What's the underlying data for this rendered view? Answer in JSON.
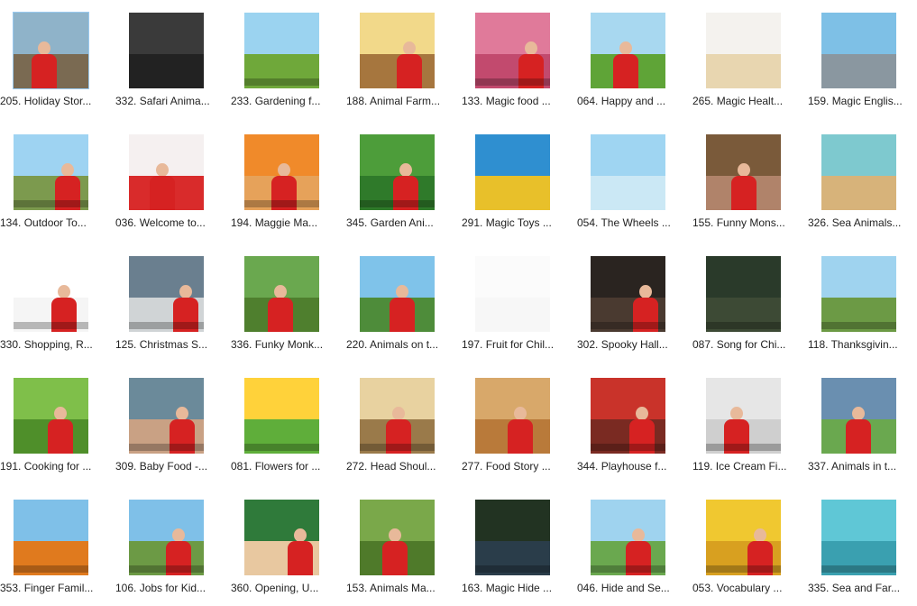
{
  "items": [
    {
      "label": "205. Holiday Stor...",
      "sky": "#8fb3c9",
      "ground": "#7a6a52",
      "person": true,
      "caption": false
    },
    {
      "label": "332. Safari Anima...",
      "sky": "#3a3a3a",
      "ground": "#222222",
      "person": false,
      "caption": false
    },
    {
      "label": "233. Gardening f...",
      "sky": "#9bd3f0",
      "ground": "#6fa83a",
      "person": false,
      "caption": true
    },
    {
      "label": "188. Animal Farm...",
      "sky": "#f2d98a",
      "ground": "#a6763e",
      "person": true,
      "caption": false
    },
    {
      "label": "133. Magic food ...",
      "sky": "#e07a9a",
      "ground": "#c24a6e",
      "person": true,
      "caption": true
    },
    {
      "label": "064. Happy and ...",
      "sky": "#a8d8f0",
      "ground": "#5fa437",
      "person": true,
      "caption": false
    },
    {
      "label": "265. Magic Healt...",
      "sky": "#f4f2ee",
      "ground": "#e8d6b0",
      "person": false,
      "caption": false
    },
    {
      "label": "159. Magic Englis...",
      "sky": "#7ec0e6",
      "ground": "#8a97a0",
      "person": false,
      "caption": false
    },
    {
      "label": "134. Outdoor To...",
      "sky": "#9ed3f2",
      "ground": "#7c9a4e",
      "person": true,
      "caption": true
    },
    {
      "label": "036. Welcome to...",
      "sky": "#f5f0f0",
      "ground": "#d92b2b",
      "person": true,
      "caption": false
    },
    {
      "label": "194. Maggie Ma...",
      "sky": "#f08a2a",
      "ground": "#e6a25a",
      "person": true,
      "caption": true
    },
    {
      "label": "345. Garden Ani...",
      "sky": "#4d9d3a",
      "ground": "#2f7a2a",
      "person": true,
      "caption": true
    },
    {
      "label": "291. Magic Toys ...",
      "sky": "#2f8fd0",
      "ground": "#e8c02a",
      "person": false,
      "caption": false
    },
    {
      "label": "054. The Wheels ...",
      "sky": "#9fd5f2",
      "ground": "#cbe8f5",
      "person": false,
      "caption": false
    },
    {
      "label": "155. Funny Mons...",
      "sky": "#7a5a3a",
      "ground": "#b0836a",
      "person": true,
      "caption": false
    },
    {
      "label": "326. Sea Animals...",
      "sky": "#7ec9cf",
      "ground": "#d7b37a",
      "person": false,
      "caption": false
    },
    {
      "label": "330. Shopping, R...",
      "sky": "#ffffff",
      "ground": "#f5f5f5",
      "person": true,
      "caption": true
    },
    {
      "label": "125. Christmas S...",
      "sky": "#6a7f8f",
      "ground": "#d0d4d6",
      "person": true,
      "caption": true
    },
    {
      "label": "336. Funky Monk...",
      "sky": "#6aa84f",
      "ground": "#4f7f2e",
      "person": true,
      "caption": false
    },
    {
      "label": "220. Animals on t...",
      "sky": "#7fc3ea",
      "ground": "#4e8c3a",
      "person": true,
      "caption": false
    },
    {
      "label": "197. Fruit for Chil...",
      "sky": "#fbfbfb",
      "ground": "#f7f7f7",
      "person": false,
      "caption": false
    },
    {
      "label": "302. Spooky Hall...",
      "sky": "#2a2420",
      "ground": "#4a3a30",
      "person": true,
      "caption": true
    },
    {
      "label": "087. Song for Chi...",
      "sky": "#2a3a2a",
      "ground": "#3d4a35",
      "person": false,
      "caption": true
    },
    {
      "label": "118. Thanksgivin...",
      "sky": "#9fd3ef",
      "ground": "#6c9a45",
      "person": false,
      "caption": true
    },
    {
      "label": "191. Cooking for ...",
      "sky": "#7fbf4a",
      "ground": "#4f8f2a",
      "person": true,
      "caption": false
    },
    {
      "label": "309. Baby Food -...",
      "sky": "#6b8a9a",
      "ground": "#c9a184",
      "person": true,
      "caption": true
    },
    {
      "label": "081. Flowers for ...",
      "sky": "#ffd23a",
      "ground": "#5fae3a",
      "person": false,
      "caption": true
    },
    {
      "label": "272. Head Shoul...",
      "sky": "#e8d2a0",
      "ground": "#9a7a4a",
      "person": true,
      "caption": true
    },
    {
      "label": "277. Food Story ...",
      "sky": "#d8a86a",
      "ground": "#b97a3a",
      "person": true,
      "caption": false
    },
    {
      "label": "344. Playhouse f...",
      "sky": "#c9332a",
      "ground": "#7a2a22",
      "person": true,
      "caption": true
    },
    {
      "label": "119. Ice Cream Fi...",
      "sky": "#e6e6e6",
      "ground": "#cfcfcf",
      "person": true,
      "caption": true
    },
    {
      "label": "337. Animals in t...",
      "sky": "#6a8fb0",
      "ground": "#6aa84f",
      "person": true,
      "caption": false
    },
    {
      "label": "353. Finger Famil...",
      "sky": "#7fc0e8",
      "ground": "#e07a1e",
      "person": false,
      "caption": true
    },
    {
      "label": "106. Jobs for Kid...",
      "sky": "#7fc0e8",
      "ground": "#6c9a45",
      "person": true,
      "caption": true
    },
    {
      "label": "360. Opening, U...",
      "sky": "#2f7a3a",
      "ground": "#e8c8a0",
      "person": true,
      "caption": false
    },
    {
      "label": "153. Animals Ma...",
      "sky": "#7aa84a",
      "ground": "#4f7a2a",
      "person": true,
      "caption": false
    },
    {
      "label": "163. Magic Hide ...",
      "sky": "#223322",
      "ground": "#2a3d4a",
      "person": false,
      "caption": true
    },
    {
      "label": "046. Hide and Se...",
      "sky": "#9fd3ef",
      "ground": "#6aa84f",
      "person": true,
      "caption": true
    },
    {
      "label": "053. Vocabulary ...",
      "sky": "#f0c830",
      "ground": "#d8a020",
      "person": true,
      "caption": true
    },
    {
      "label": "335. Sea and Far...",
      "sky": "#5fc7d6",
      "ground": "#3aa0b0",
      "person": false,
      "caption": true
    }
  ]
}
